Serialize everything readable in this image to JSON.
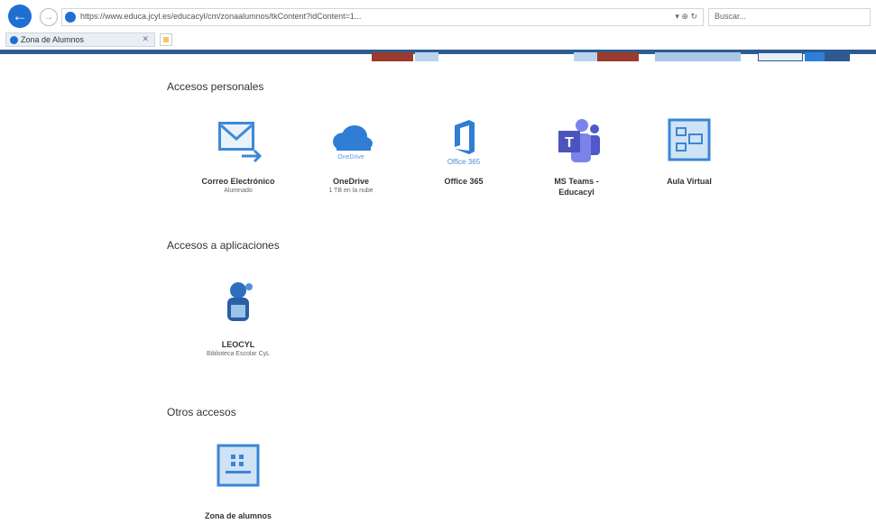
{
  "browser": {
    "url": "https://www.educa.jcyl.es/educacyl/cm/zonaalumnos/tkContent?idContent=1...",
    "url_controls": "▾ ⊕ ↻",
    "search_placeholder": "Buscar...",
    "tab_title": "Zona de Alumnos",
    "tab_close": "✕"
  },
  "sections": {
    "personal": {
      "title": "Accesos personales",
      "items": [
        {
          "name": "Correo Electrónico",
          "sub": "Alumnado"
        },
        {
          "name": "OneDrive",
          "sub": "1 TB en la nube",
          "logo_text": "OneDrive"
        },
        {
          "name": "Office 365",
          "sub": "",
          "logo_text": "Office 365"
        },
        {
          "name": "MS Teams -",
          "sub": "",
          "name2": "Educacyl"
        },
        {
          "name": "Aula Virtual",
          "sub": ""
        }
      ]
    },
    "apps": {
      "title": "Accesos a aplicaciones",
      "items": [
        {
          "name": "LEOCYL",
          "sub": "Biblioteca Escolar CyL"
        }
      ]
    },
    "other": {
      "title": "Otros accesos",
      "items": [
        {
          "name": "Zona de alumnos",
          "sub": ""
        }
      ]
    }
  },
  "colors": {
    "accent_blue": "#2d6fc0",
    "header_strip": "#2d5b91",
    "nav_red": "#9b3b2f",
    "teams_purple": "#5059c9"
  }
}
